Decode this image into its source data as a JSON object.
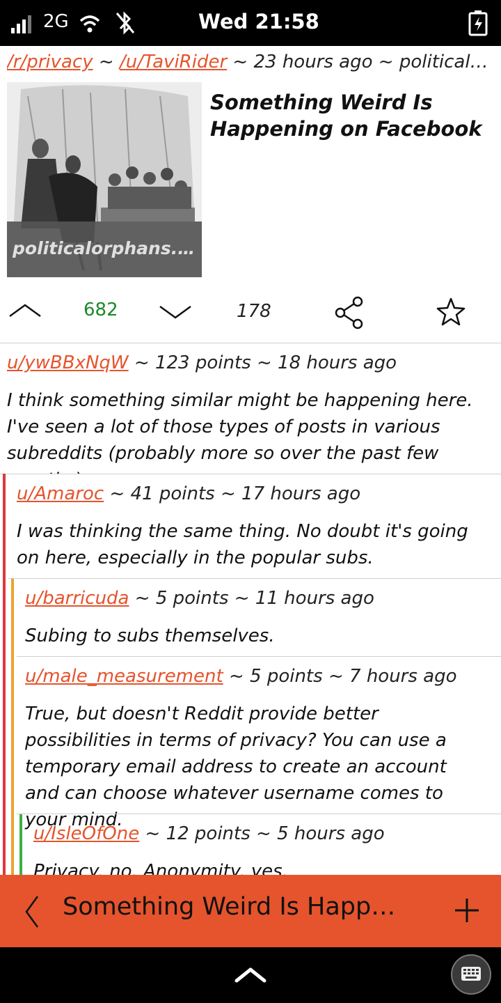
{
  "status_bar": {
    "network": "2G",
    "time": "Wed 21:58"
  },
  "post": {
    "subreddit": "/r/privacy",
    "separator": "~",
    "author": "/u/TaviRider",
    "age": "23 hours ago",
    "domain": "politicalorph…",
    "thumbnail_caption": "politicalorphans.c…",
    "title": "Something Weird Is Happening on Facebook",
    "score": "682",
    "comment_count": "178",
    "score_color": "#1a8a2a"
  },
  "comments": [
    {
      "author": "u/ywBBxNqW",
      "points": "123 points",
      "age": "18 hours ago",
      "body": "I think something similar might be happening here. I've seen a lot of those types of posts in various subreddits (probably more so over the past few months)"
    },
    {
      "author": "u/Amaroc",
      "points": "41 points",
      "age": "17 hours ago",
      "body": "I was thinking the same thing. No doubt it's going on here, especially in the popular subs."
    },
    {
      "author": "u/barricuda",
      "points": "5 points",
      "age": "11 hours ago",
      "body": "Subing to subs themselves."
    },
    {
      "author": "u/male_measurement",
      "points": "5 points",
      "age": "7 hours ago",
      "body": "True, but doesn't Reddit provide better possibilities in terms of privacy? You can use a temporary email address to create an account and can choose whatever username comes to your mind."
    },
    {
      "author": "u/IsleOfOne",
      "points": "12 points",
      "age": "5 hours ago",
      "body": "Privacy, no. Anonymity, yes."
    }
  ],
  "nav": {
    "title": "Something Weird Is Happ…"
  },
  "colors": {
    "accent": "#e5542d",
    "depth1": "#e0373f",
    "depth2": "#f0a030",
    "depth3": "#3cb043"
  }
}
